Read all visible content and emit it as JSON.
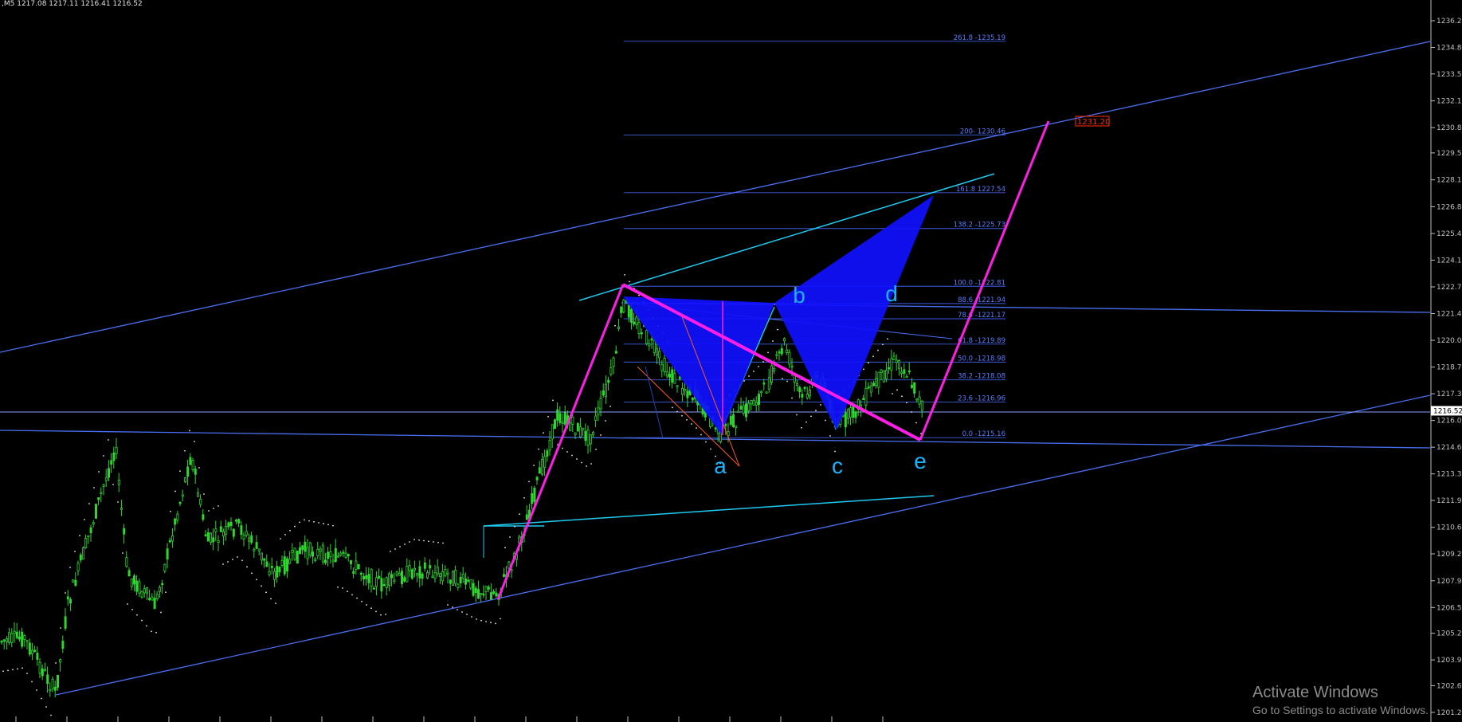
{
  "header": {
    "ohlc": ",M5  1217.08 1217.11 1216.41 1216.52"
  },
  "watermark": {
    "title": "Activate Windows",
    "subtitle": "Go to Settings to activate Windows."
  },
  "chart_data": {
    "type": "candlestick",
    "price_axis": {
      "min": 1201.28,
      "max": 1237.0,
      "ticks": [
        "1236.23",
        "1234.88",
        "1233.54",
        "1232.18",
        "1230.83",
        "1229.55",
        "1228.19",
        "1226.83",
        "1225.48",
        "1224.13",
        "1222.78",
        "1221.43",
        "1220.08",
        "1218.73",
        "1217.38",
        "1216.03",
        "1214.68",
        "1213.33",
        "1211.99",
        "1210.63",
        "1209.29",
        "1207.93",
        "1206.58",
        "1205.28",
        "1203.93",
        "1202.63",
        "1201.28"
      ],
      "current_price": "1216.52",
      "target_price": "1231.20"
    },
    "fibonacci": [
      {
        "label": "261.8 -1235.19",
        "price": 1235.19
      },
      {
        "label": "200- 1230.46",
        "price": 1230.46
      },
      {
        "label": "161.8 1227.54",
        "price": 1227.54
      },
      {
        "label": "138.2  -1225.73",
        "price": 1225.73
      },
      {
        "label": "100.0 -1222.81",
        "price": 1222.81
      },
      {
        "label": "88.6 -1221.94",
        "price": 1221.94
      },
      {
        "label": "78.6 -1221.17",
        "price": 1221.17
      },
      {
        "label": "61.8 -1219.89",
        "price": 1219.89
      },
      {
        "label": "50.0 -1218.98",
        "price": 1218.98
      },
      {
        "label": "38.2 -1218.08",
        "price": 1218.08
      },
      {
        "label": "23.6 -1216.96",
        "price": 1216.96
      },
      {
        "label": "0.0 -1215.16",
        "price": 1215.16
      }
    ],
    "wave_labels": [
      "a",
      "b",
      "c",
      "d",
      "e"
    ],
    "colors": {
      "candle": "#2ed62e",
      "channel": "#4a6ef0",
      "cyan": "#1ecaf0",
      "magenta": "#ff1ee6",
      "harmonic": "#1414ff",
      "price_label": "#ff2a00"
    }
  }
}
